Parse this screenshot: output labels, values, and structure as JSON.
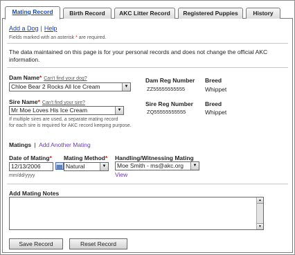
{
  "tabs": [
    {
      "label": "Mating Record"
    },
    {
      "label": "Birth Record"
    },
    {
      "label": "AKC Litter Record"
    },
    {
      "label": "Registered Puppies"
    },
    {
      "label": "History"
    }
  ],
  "links": {
    "add_dog": "Add a Dog",
    "separator": "|",
    "help": "Help"
  },
  "required_note": {
    "before": "Fields marked with an asterisk",
    "star": "*",
    "after": "are required."
  },
  "info_text": "The data maintained on this page is for your personal records and does not change the official AKC information.",
  "dam": {
    "label": "Dam Name",
    "star": "*",
    "hint": "Can't find your dog?",
    "value": "Chloe Bear 2 Rocks All Ice Cream",
    "reg_label": "Dam Reg Number",
    "reg_value": "ZZ55555555555",
    "breed_label": "Breed",
    "breed_value": "Whippet"
  },
  "sire": {
    "label": "Sire Name",
    "star": "*",
    "hint": "Can't find your sire?",
    "value": "Mr Moe Loves His Ice Cream",
    "reg_label": "Sire Reg Number",
    "reg_value": "ZQ55555555555",
    "breed_label": "Breed",
    "breed_value": "Whippet",
    "note_line1": "If multiple sires are used, a separate mating record",
    "note_line2": "for each sire is required for AKC record keeping purpose."
  },
  "matings": {
    "label": "Matings",
    "separator": "|",
    "add_link": "Add Another Mating"
  },
  "date_of_mating": {
    "label": "Date of Mating",
    "star": "*",
    "value": "12/13/2006",
    "format_hint": "mm/dd/yyyy"
  },
  "mating_method": {
    "label": "Mating Method",
    "star": "*",
    "value": "Natural"
  },
  "handling": {
    "label": "Handling/Witnessing Mating",
    "value": "Moe Smith - ms@akc.org",
    "view_link": "View"
  },
  "notes": {
    "label": "Add Mating Notes",
    "value": ""
  },
  "buttons": {
    "save": "Save Record",
    "reset": "Reset Record"
  }
}
